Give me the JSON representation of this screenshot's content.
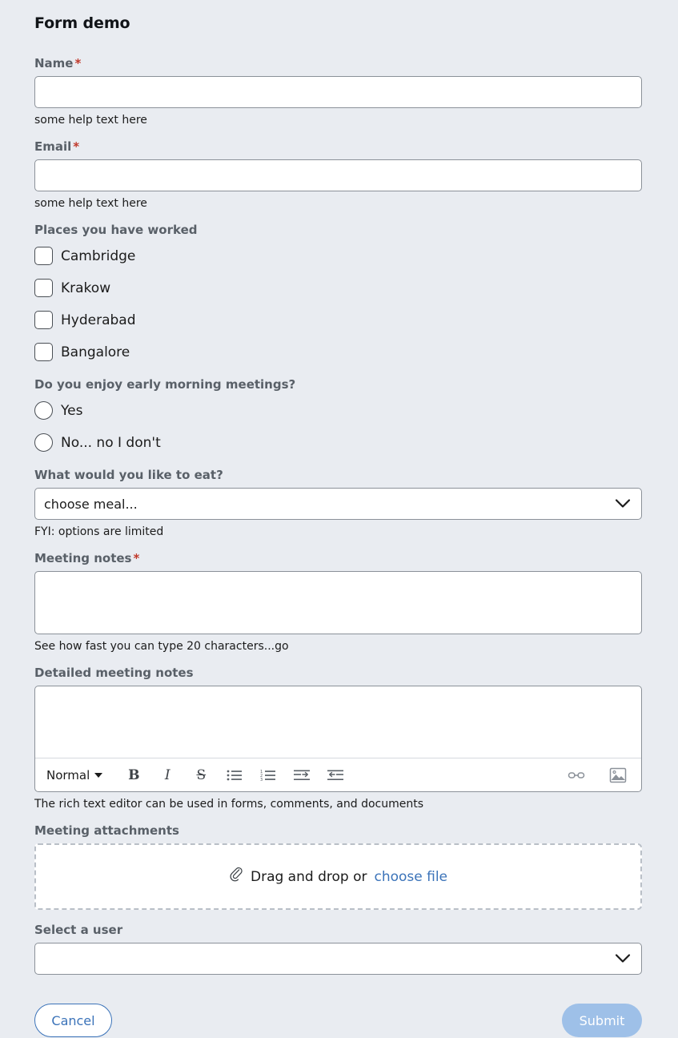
{
  "form": {
    "title": "Form demo",
    "fields": {
      "name": {
        "label": "Name",
        "required_marker": "*",
        "value": "",
        "help": "some help text here"
      },
      "email": {
        "label": "Email",
        "required_marker": "*",
        "value": "",
        "help": "some help text here"
      },
      "places": {
        "label": "Places you have worked",
        "options": [
          {
            "label": "Cambridge",
            "checked": false
          },
          {
            "label": "Krakow",
            "checked": false
          },
          {
            "label": "Hyderabad",
            "checked": false
          },
          {
            "label": "Bangalore",
            "checked": false
          }
        ]
      },
      "early_meetings": {
        "label": "Do you enjoy early morning meetings?",
        "options": [
          {
            "label": "Yes",
            "selected": false
          },
          {
            "label": "No... no I don't",
            "selected": false
          }
        ]
      },
      "meal": {
        "label": "What would you like to eat?",
        "selected": "choose meal...",
        "help": "FYI: options are limited"
      },
      "meeting_notes": {
        "label": "Meeting notes",
        "required_marker": "*",
        "value": "",
        "help": "See how fast you can type 20 characters...go"
      },
      "detailed_notes": {
        "label": "Detailed meeting notes",
        "value": "",
        "help": "The rich text editor can be used in forms, comments, and documents",
        "toolbar": {
          "style_label": "Normal",
          "bold": "B",
          "italic": "I",
          "strikethrough": "S",
          "bullet_list": "bullet-list-icon",
          "numbered_list": "numbered-list-icon",
          "indent": "indent-icon",
          "outdent": "outdent-icon",
          "link": "link-icon",
          "image": "image-icon"
        }
      },
      "attachments": {
        "label": "Meeting attachments",
        "drop_text": "Drag and drop or",
        "link_text": "choose file",
        "icon": "paperclip-icon"
      },
      "user_select": {
        "label": "Select a user",
        "selected": ""
      }
    },
    "actions": {
      "cancel": "Cancel",
      "submit": "Submit"
    }
  },
  "colors": {
    "background": "#e9ecf1",
    "accent_blue": "#3b73b9",
    "submit_disabled": "#9ec0e8",
    "required_red": "#c0392b",
    "label_gray": "#596068",
    "border_gray": "#8b9199"
  }
}
